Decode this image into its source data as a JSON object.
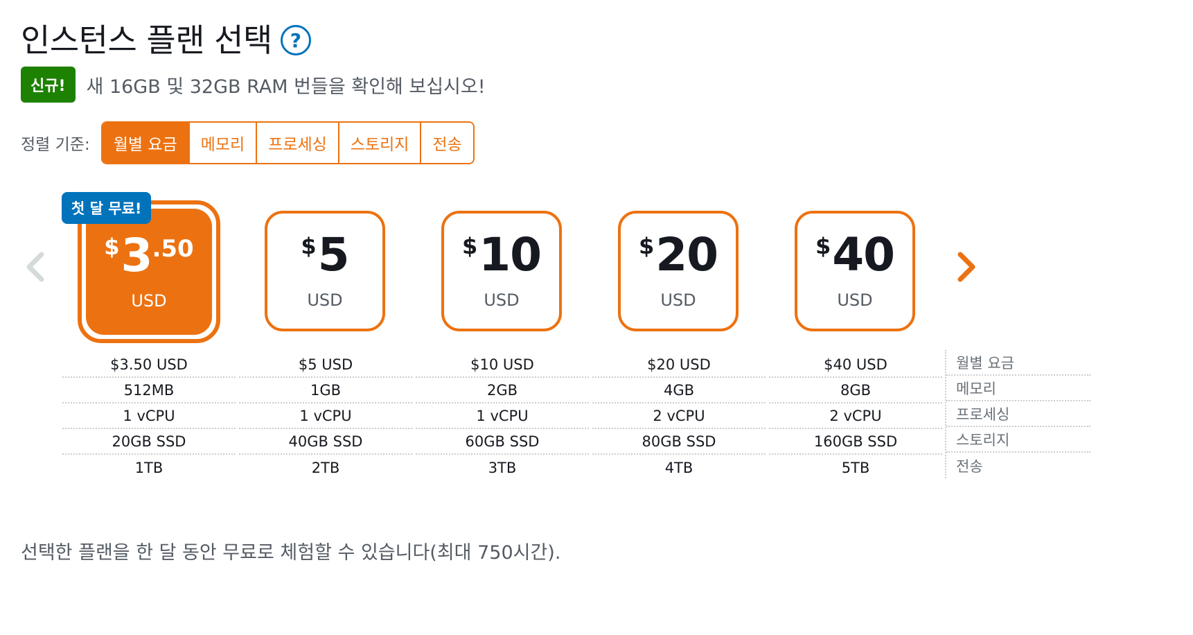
{
  "header": {
    "title": "인스턴스 플랜 선택",
    "help_icon": "question-circle-icon"
  },
  "announcement": {
    "badge": "신규!",
    "text": "새 16GB 및 32GB RAM 번들을 확인해 보십시오!"
  },
  "sort": {
    "label": "정렬 기준:",
    "options": [
      "월별 요금",
      "메모리",
      "프로세싱",
      "스토리지",
      "전송"
    ],
    "active": "월별 요금"
  },
  "carousel": {
    "prev_icon": "chevron-left-icon",
    "next_icon": "chevron-right-icon",
    "free_badge": "첫 달 무료!",
    "plans": [
      {
        "currency": "$",
        "amount": "3",
        "cents": ".50",
        "unit": "USD",
        "selected": true,
        "monthly": "$3.50 USD",
        "memory": "512MB",
        "cpu": "1 vCPU",
        "storage": "20GB SSD",
        "transfer": "1TB"
      },
      {
        "currency": "$",
        "amount": "5",
        "cents": "",
        "unit": "USD",
        "selected": false,
        "monthly": "$5 USD",
        "memory": "1GB",
        "cpu": "1 vCPU",
        "storage": "40GB SSD",
        "transfer": "2TB"
      },
      {
        "currency": "$",
        "amount": "10",
        "cents": "",
        "unit": "USD",
        "selected": false,
        "monthly": "$10 USD",
        "memory": "2GB",
        "cpu": "1 vCPU",
        "storage": "60GB SSD",
        "transfer": "3TB"
      },
      {
        "currency": "$",
        "amount": "20",
        "cents": "",
        "unit": "USD",
        "selected": false,
        "monthly": "$20 USD",
        "memory": "4GB",
        "cpu": "2 vCPU",
        "storage": "80GB SSD",
        "transfer": "4TB"
      },
      {
        "currency": "$",
        "amount": "40",
        "cents": "",
        "unit": "USD",
        "selected": false,
        "monthly": "$40 USD",
        "memory": "8GB",
        "cpu": "2 vCPU",
        "storage": "160GB SSD",
        "transfer": "5TB"
      }
    ]
  },
  "spec_labels": [
    "월별 요금",
    "메모리",
    "프로세싱",
    "스토리지",
    "전송"
  ],
  "footer": {
    "note": "선택한 플랜을 한 달 동안 무료로 체험할 수 있습니다(최대 750시간)."
  },
  "colors": {
    "accent": "#ec7211",
    "new_badge": "#1d8102",
    "info": "#0073bb",
    "chevron_disabled": "#d5dbdb"
  }
}
